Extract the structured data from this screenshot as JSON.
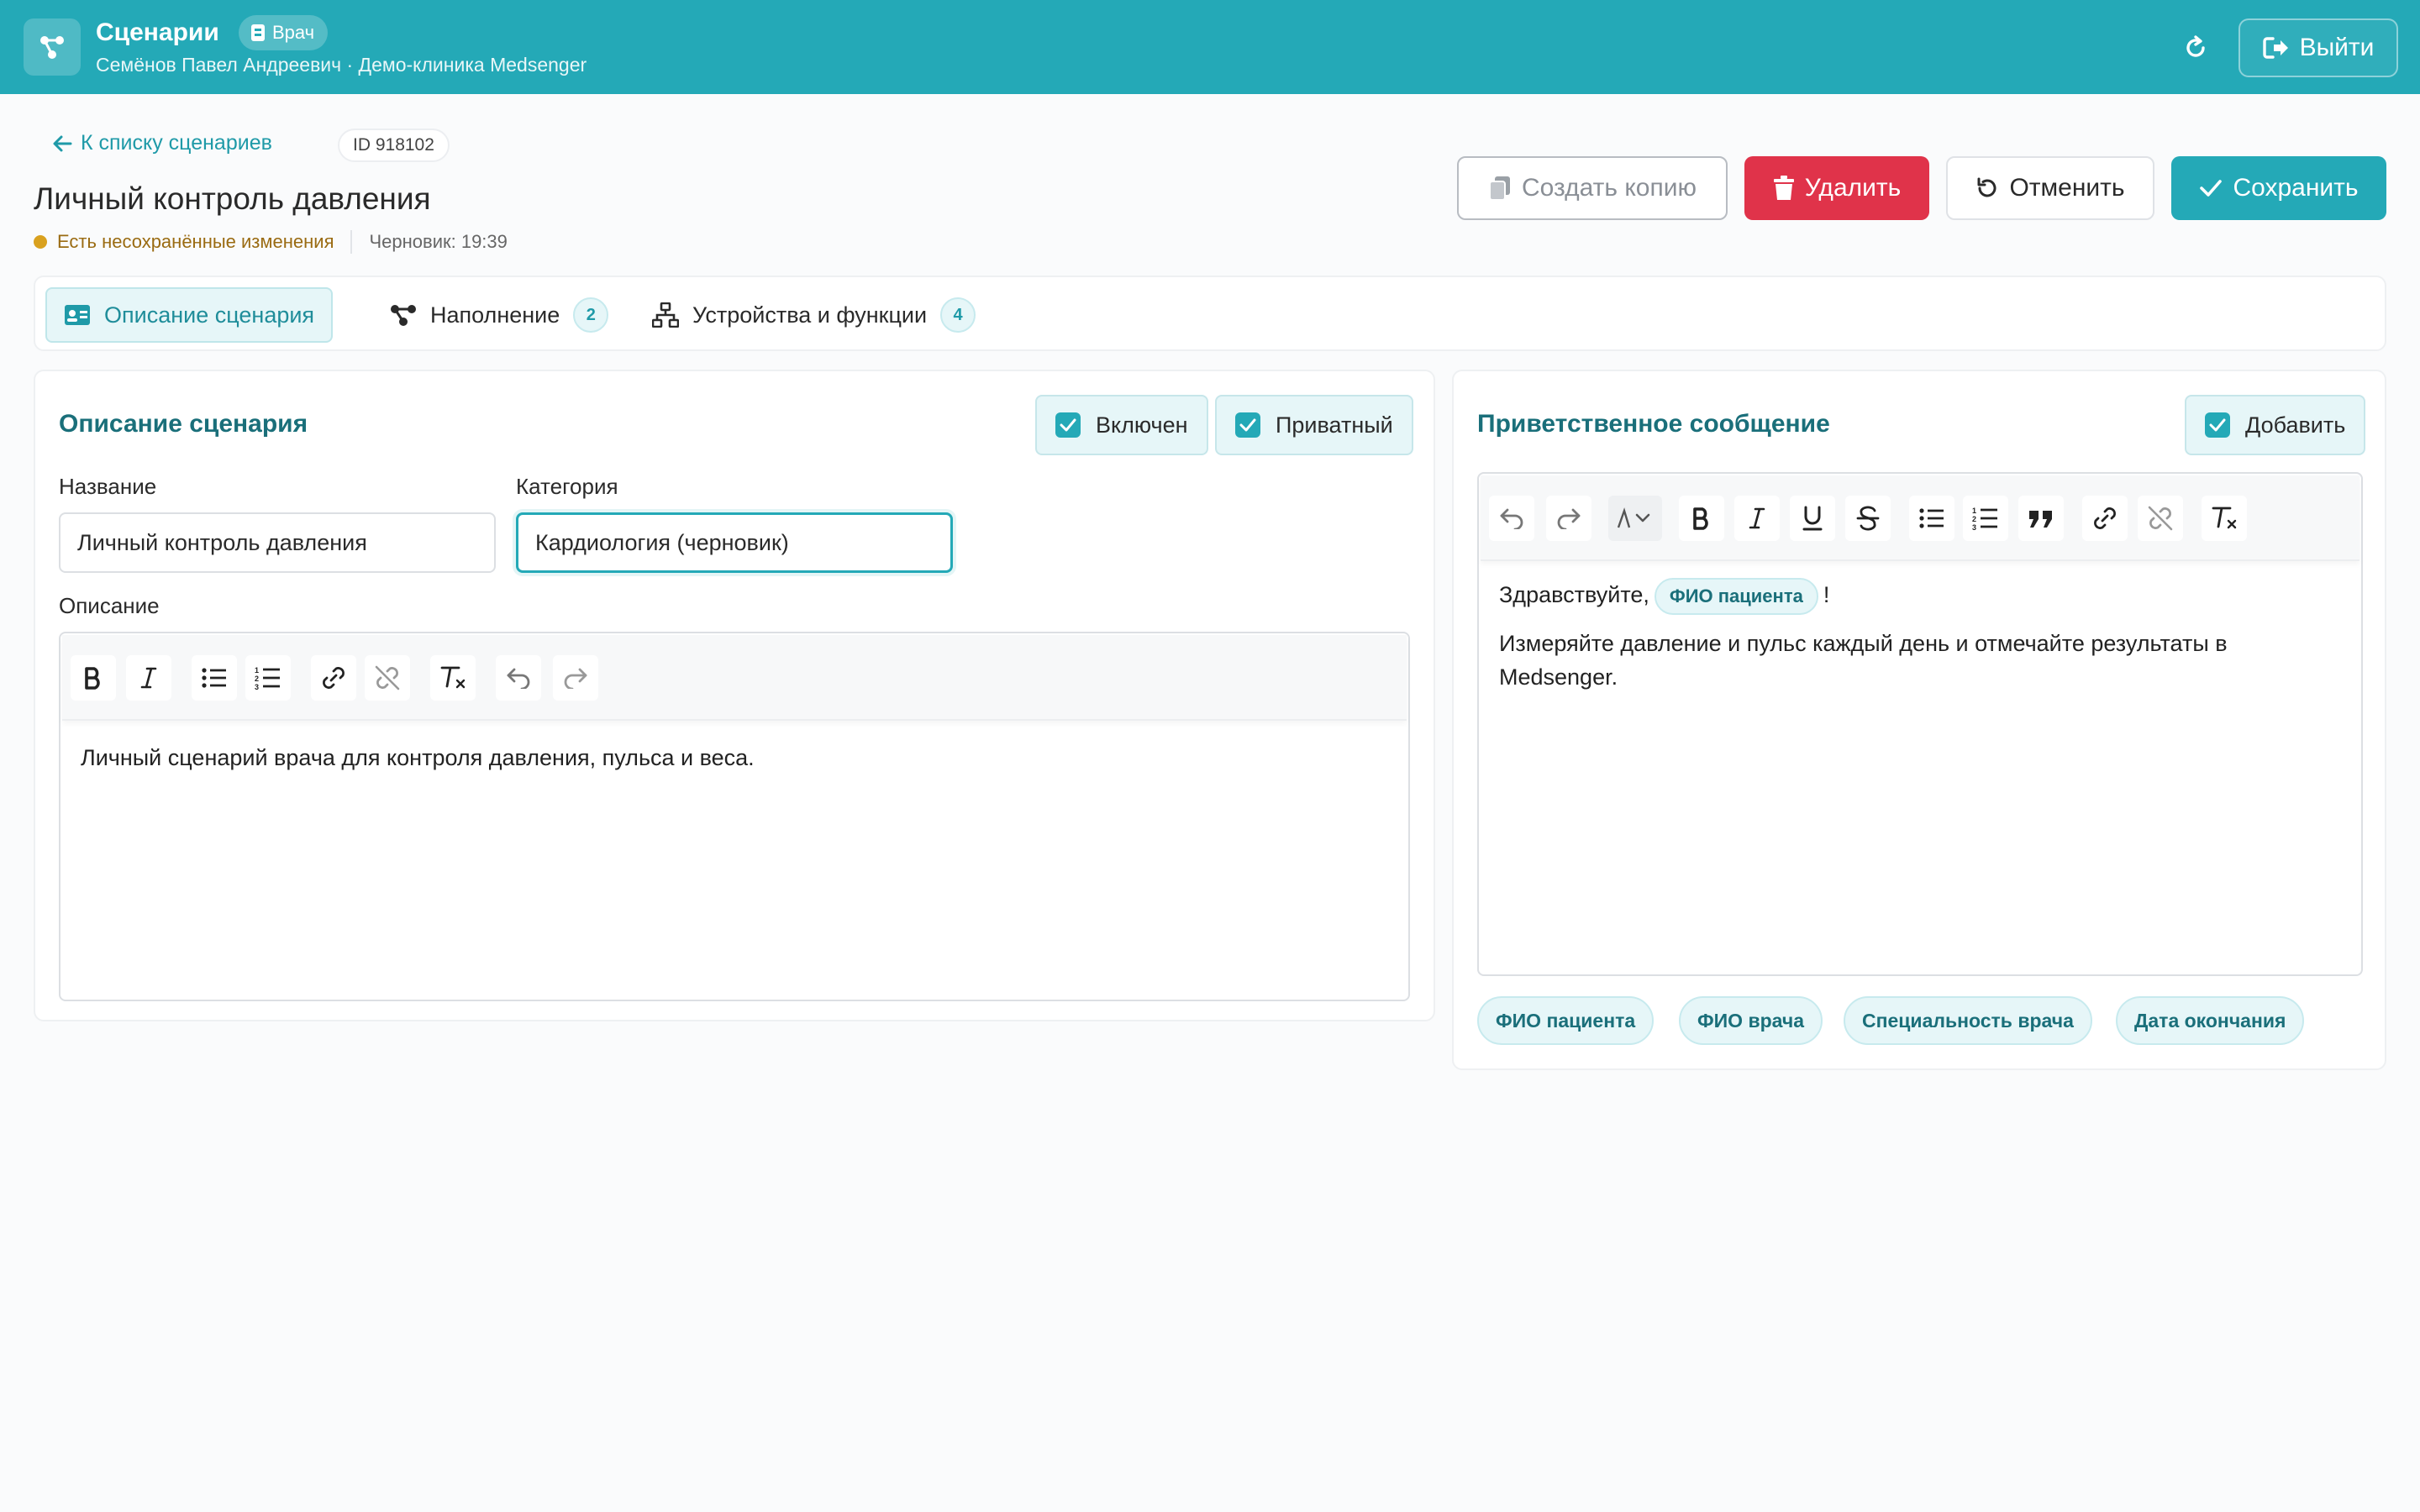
{
  "header": {
    "app_title": "Сценарии",
    "role": "Врач",
    "user_line": "Семёнов Павел Андреевич · Демо-клиника Medsenger",
    "logout_label": "Выйти"
  },
  "page": {
    "back_label": "К списку сценариев",
    "id_label": "ID 918102",
    "title": "Личный контроль давления",
    "unsaved_label": "Есть несохранённые изменения",
    "draft_label": "Черновик: 19:39"
  },
  "actions": {
    "copy_label": "Создать копию",
    "delete_label": "Удалить",
    "cancel_label": "Отменить",
    "save_label": "Сохранить"
  },
  "tabs": [
    {
      "label": "Описание сценария"
    },
    {
      "label": "Наполнение",
      "count": "2"
    },
    {
      "label": "Устройства и функции",
      "count": "4"
    }
  ],
  "description_card": {
    "title": "Описание сценария",
    "enabled_label": "Включен",
    "private_label": "Приватный",
    "name_label": "Название",
    "name_value": "Личный контроль давления",
    "category_label": "Категория",
    "category_value": "Кардиология (черновик)",
    "description_label": "Описание",
    "description_text": "Личный сценарий врача для контроля давления, пульса и веса."
  },
  "welcome_card": {
    "title": "Приветственное сообщение",
    "add_label": "Добавить",
    "greeting": "Здравствуйте,",
    "greeting_chip": "ФИО пациента",
    "greeting_end": "!",
    "body": "Измеряйте давление и пульс каждый день и отмечайте результаты в Medsenger.",
    "variables": [
      "ФИО пациента",
      "ФИО врача",
      "Специальность врача",
      "Дата окончания"
    ]
  },
  "colors": {
    "accent": "#24a9b7",
    "danger": "#e0334a",
    "warning_dot": "#d9a11f"
  }
}
